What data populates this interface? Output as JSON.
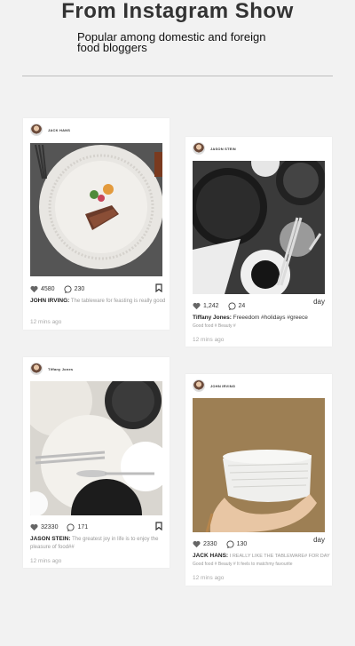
{
  "header": {
    "title": "From Instagram Show",
    "subtitle": "Popular among domestic and foreign food bloggers"
  },
  "cards": [
    {
      "user": "JACK HANS",
      "likes": "4580",
      "comments": "230",
      "author": "JOHN IRVING:",
      "caption": "The tableware for feasting is really good",
      "tags": "",
      "time": "12 mins ago",
      "end": "bookmark-icon"
    },
    {
      "user": "JASON STEIN",
      "likes": "1,242",
      "comments": "24",
      "author": "Tiffany Jones:",
      "caption": "Freeedom #holidays #greece",
      "tags": "Good food # Beauty #",
      "time": "12 mins ago",
      "end_text": "day"
    },
    {
      "user": "Tiffany Jones",
      "likes": "32330",
      "comments": "171",
      "author": "JASON STEIN:",
      "caption": "The greatest joy in life is to enjoy the pleasure of food##",
      "tags": "",
      "time": "12 mins ago",
      "end": "bookmark-icon"
    },
    {
      "user": "JOHN IRVING",
      "likes": "2330",
      "comments": "130",
      "author": "JACK HANS:",
      "caption": "I REALLY LIKE THE TABLEWARE# FOR DAY",
      "tags": "Good food # Beauty # It feels to matchmy favourite",
      "time": "12 mins ago",
      "end_text": "day"
    }
  ]
}
